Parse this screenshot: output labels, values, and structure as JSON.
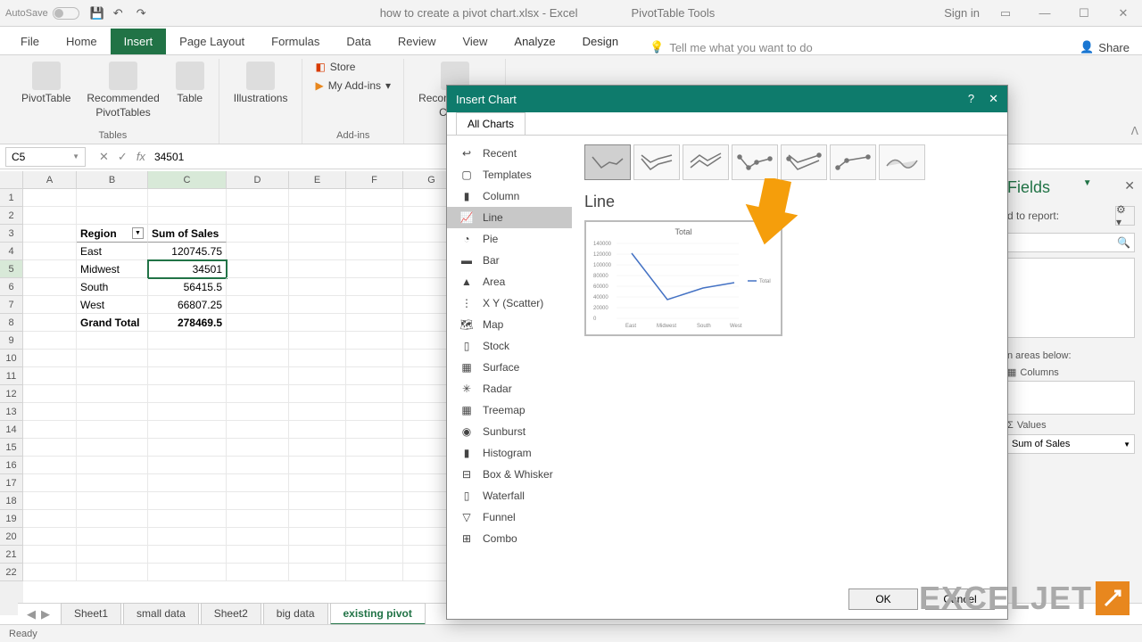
{
  "titlebar": {
    "autosave": "AutoSave",
    "filename": "how to create a pivot chart.xlsx - Excel",
    "tools": "PivotTable Tools",
    "signin": "Sign in"
  },
  "tabs": {
    "file": "File",
    "home": "Home",
    "insert": "Insert",
    "pagelayout": "Page Layout",
    "formulas": "Formulas",
    "data": "Data",
    "review": "Review",
    "view": "View",
    "analyze": "Analyze",
    "design": "Design",
    "tellme": "Tell me what you want to do",
    "share": "Share"
  },
  "ribbon": {
    "pivottable": "PivotTable",
    "recpivot1": "Recommended",
    "recpivot2": "PivotTables",
    "table": "Table",
    "illustrations": "Illustrations",
    "store": "Store",
    "myaddins": "My Add-ins",
    "recchart1": "Recommended",
    "recchart2": "Charts",
    "group_tables": "Tables",
    "group_addins": "Add-ins"
  },
  "formula": {
    "namebox": "C5",
    "value": "34501"
  },
  "grid": {
    "cols": [
      "A",
      "B",
      "C",
      "D",
      "E",
      "F",
      "G"
    ],
    "data": [
      {
        "row": 3,
        "B": "Region",
        "C": "Sum of Sales",
        "header": true
      },
      {
        "row": 4,
        "B": "East",
        "C": "120745.75"
      },
      {
        "row": 5,
        "B": "Midwest",
        "C": "34501",
        "sel": true
      },
      {
        "row": 6,
        "B": "South",
        "C": "56415.5"
      },
      {
        "row": 7,
        "B": "West",
        "C": "66807.25"
      },
      {
        "row": 8,
        "B": "Grand Total",
        "C": "278469.5",
        "bold": true
      }
    ]
  },
  "sheets": [
    "Sheet1",
    "small data",
    "Sheet2",
    "big data",
    "existing pivot"
  ],
  "active_sheet": "existing pivot",
  "status": "Ready",
  "fields": {
    "title": "Fields",
    "subtitle": "d to report:",
    "areas": "n areas below:",
    "columns": "Columns",
    "values": "Values",
    "sumof": "Sum of Sales"
  },
  "dialog": {
    "title": "Insert Chart",
    "tab": "All Charts",
    "types": [
      "Recent",
      "Templates",
      "Column",
      "Line",
      "Pie",
      "Bar",
      "Area",
      "X Y (Scatter)",
      "Map",
      "Stock",
      "Surface",
      "Radar",
      "Treemap",
      "Sunburst",
      "Histogram",
      "Box & Whisker",
      "Waterfall",
      "Funnel",
      "Combo"
    ],
    "selected_type": "Line",
    "chart_name": "Line",
    "preview_title": "Total",
    "preview_legend": "Total",
    "ok": "OK",
    "cancel": "Cancel"
  },
  "chart_data": {
    "type": "line",
    "title": "Total",
    "categories": [
      "East",
      "Midwest",
      "South",
      "West"
    ],
    "series": [
      {
        "name": "Total",
        "values": [
          120745.75,
          34501,
          56415.5,
          66807.25
        ]
      }
    ],
    "ylim": [
      0,
      140000
    ],
    "yticks": [
      0,
      20000,
      40000,
      60000,
      80000,
      100000,
      120000,
      140000
    ],
    "xlabel": "",
    "ylabel": ""
  },
  "logo": "EXCELJET"
}
